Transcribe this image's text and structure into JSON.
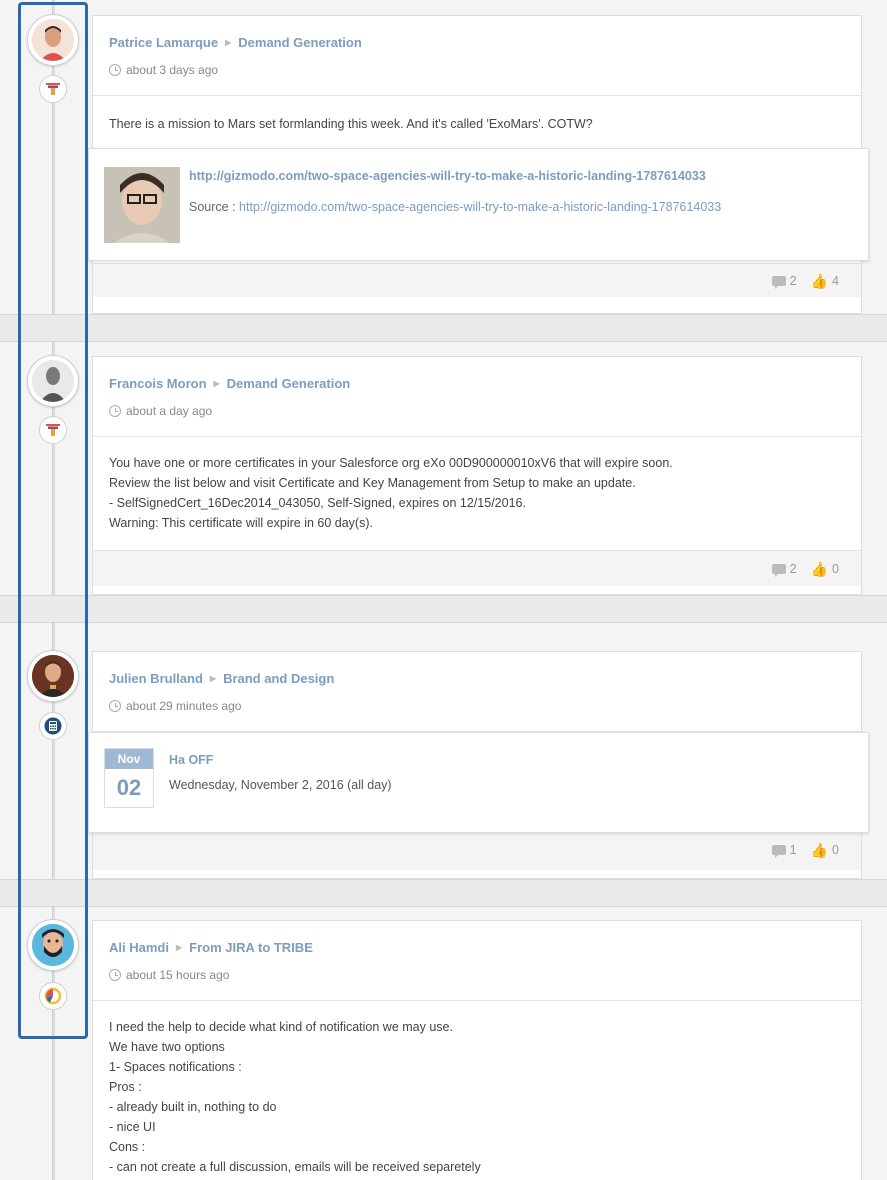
{
  "posts": [
    {
      "author": "Patrice Lamarque",
      "space": "Demand Generation",
      "time": "about 3 days ago",
      "body": "There is a mission to Mars set formlanding this week. And it's called 'ExoMars'. COTW?",
      "link": {
        "title": "http://gizmodo.com/two-space-agencies-will-try-to-make-a-historic-landing-1787614033",
        "source_label": "Source :",
        "source_url": "http://gizmodo.com/two-space-agencies-will-try-to-make-a-historic-landing-1787614033"
      },
      "comments": "2",
      "likes": "4",
      "avatar_icon": "user-avatar",
      "badge_icon": "funnel-icon"
    },
    {
      "author": "Francois Moron",
      "space": "Demand Generation",
      "time": "about a day ago",
      "body_lines": [
        "You have one or more certificates in your Salesforce org eXo 00D900000010xV6 that will expire soon.",
        "Review the list below and visit Certificate and Key Management from Setup to make an update.",
        "- SelfSignedCert_16Dec2014_043050, Self-Signed, expires on 12/15/2016.",
        "Warning: This certificate will expire in 60 day(s)."
      ],
      "comments": "2",
      "likes": "0",
      "badge_icon": "funnel-icon"
    },
    {
      "author": "Julien Brulland",
      "space": "Brand and Design",
      "time": "about 29 minutes ago",
      "event": {
        "month": "Nov",
        "day": "02",
        "title": "Ha OFF",
        "date": "Wednesday, November 2, 2016 (all day)"
      },
      "comments": "1",
      "likes": "0",
      "badge_icon": "calculator-icon"
    },
    {
      "author": "Ali Hamdi",
      "space": "From JIRA to TRIBE",
      "time": "about 15 hours ago",
      "body_lines": [
        "I need the help to decide what kind of notification we may use.",
        "We have two options",
        "1- Spaces notifications :",
        "Pros :",
        "- already built in, nothing to do",
        "- nice UI",
        "Cons :",
        "- can not create a full discussion, emails will be received separetely"
      ],
      "badge_icon": "pie-chart-icon"
    }
  ],
  "colors": {
    "link": "#7c9cc0",
    "selection": "#2b6aa8",
    "calendar_header": "#9fb8d5"
  }
}
